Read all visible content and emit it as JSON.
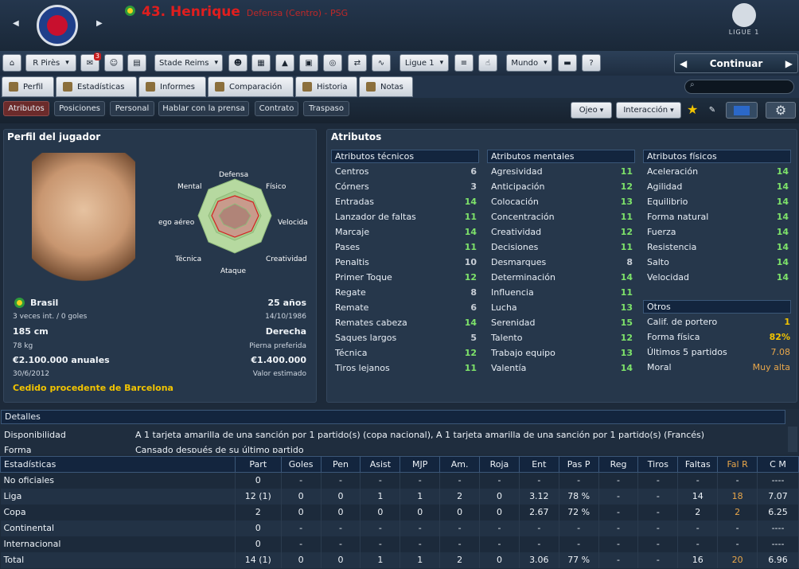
{
  "header": {
    "number_name": "43. Henrique",
    "position": "Defensa (Centro) - PSG",
    "league_logo_text": "LIGUE 1",
    "nav_prev": "◀",
    "nav_next": "▶"
  },
  "toolbar": {
    "manager": "R Pirès",
    "inbox_count": "3",
    "team": "Stade Reims",
    "competition": "Ligue 1",
    "world": "Mundo",
    "help": "?",
    "continue_label": "Continuar"
  },
  "tabs": [
    {
      "label": "Perfil"
    },
    {
      "label": "Estadísticas"
    },
    {
      "label": "Informes"
    },
    {
      "label": "Comparación"
    },
    {
      "label": "Historia"
    },
    {
      "label": "Notas"
    }
  ],
  "subtabs": [
    {
      "label": "Atributos"
    },
    {
      "label": "Posiciones"
    },
    {
      "label": "Personal"
    },
    {
      "label": "Hablar con la prensa"
    },
    {
      "label": "Contrato"
    },
    {
      "label": "Traspaso"
    }
  ],
  "view": {
    "eye": "Ojeo",
    "interaction": "Interacción"
  },
  "profile": {
    "title": "Perfil del jugador",
    "radar": {
      "top": "Defensa",
      "tr": "Físico",
      "r": "Velocida",
      "br": "Creatividad",
      "b": "Ataque",
      "bl": "Técnica",
      "l": "ego aéreo",
      "tl": "Mental"
    },
    "nation": "Brasil",
    "age": "25 años",
    "caps": "3 veces int. / 0 goles",
    "dob": "14/10/1986",
    "height": "185 cm",
    "foot": "Derecha",
    "weight": "78 kg",
    "foot_label": "Pierna preferida",
    "wage": "€2.100.000 anuales",
    "value": "€1.400.000",
    "contract_end": "30/6/2012",
    "value_label": "Valor estimado",
    "loan": "Cedido procedente de Barcelona"
  },
  "attributes": {
    "title": "Atributos",
    "technical": {
      "title": "Atributos técnicos",
      "items": [
        [
          "Centros",
          "6"
        ],
        [
          "Córners",
          "3"
        ],
        [
          "Entradas",
          "14"
        ],
        [
          "Lanzador de faltas",
          "11"
        ],
        [
          "Marcaje",
          "14"
        ],
        [
          "Pases",
          "11"
        ],
        [
          "Penaltis",
          "10"
        ],
        [
          "Primer Toque",
          "12"
        ],
        [
          "Regate",
          "8"
        ],
        [
          "Remate",
          "6"
        ],
        [
          "Remates cabeza",
          "14"
        ],
        [
          "Saques largos",
          "5"
        ],
        [
          "Técnica",
          "12"
        ],
        [
          "Tiros lejanos",
          "11"
        ]
      ]
    },
    "mental": {
      "title": "Atributos mentales",
      "items": [
        [
          "Agresividad",
          "11"
        ],
        [
          "Anticipación",
          "12"
        ],
        [
          "Colocación",
          "13"
        ],
        [
          "Concentración",
          "11"
        ],
        [
          "Creatividad",
          "12"
        ],
        [
          "Decisiones",
          "11"
        ],
        [
          "Desmarques",
          "8"
        ],
        [
          "Determinación",
          "14"
        ],
        [
          "Influencia",
          "11"
        ],
        [
          "Lucha",
          "13"
        ],
        [
          "Serenidad",
          "15"
        ],
        [
          "Talento",
          "12"
        ],
        [
          "Trabajo equipo",
          "13"
        ],
        [
          "Valentía",
          "14"
        ]
      ]
    },
    "physical": {
      "title": "Atributos físicos",
      "items": [
        [
          "Aceleración",
          "14"
        ],
        [
          "Agilidad",
          "14"
        ],
        [
          "Equilibrio",
          "14"
        ],
        [
          "Forma natural",
          "14"
        ],
        [
          "Fuerza",
          "14"
        ],
        [
          "Resistencia",
          "14"
        ],
        [
          "Salto",
          "14"
        ],
        [
          "Velocidad",
          "14"
        ]
      ]
    },
    "other": {
      "title": "Otros",
      "items": [
        [
          "Calif. de portero",
          "1"
        ],
        [
          "Forma física",
          "82%"
        ],
        [
          "Últimos 5 partidos",
          "7.08"
        ],
        [
          "Moral",
          "Muy alta"
        ]
      ]
    }
  },
  "details": {
    "title": "Detalles",
    "rows": [
      [
        "Disponibilidad",
        "A 1 tarjeta amarilla de una sanción por 1 partido(s) (copa nacional), A 1 tarjeta amarilla de una sanción por 1 partido(s) (Francés)"
      ],
      [
        "Forma",
        "Cansado después de su último partido"
      ]
    ]
  },
  "stats": {
    "headers": [
      "Estadísticas",
      "Part",
      "Goles",
      "Pen",
      "Asist",
      "MJP",
      "Am.",
      "Roja",
      "Ent",
      "Pas P",
      "Reg",
      "Tiros",
      "Faltas",
      "Fal R",
      "C M"
    ],
    "rows": [
      [
        "No oficiales",
        "0",
        "-",
        "-",
        "-",
        "-",
        "-",
        "-",
        "-",
        "-",
        "-",
        "-",
        "-",
        "-",
        "----"
      ],
      [
        "Liga",
        "12 (1)",
        "0",
        "0",
        "1",
        "1",
        "2",
        "0",
        "3.12",
        "78 %",
        "-",
        "-",
        "14",
        "18",
        "7.07"
      ],
      [
        "Copa",
        "2",
        "0",
        "0",
        "0",
        "0",
        "0",
        "0",
        "2.67",
        "72 %",
        "-",
        "-",
        "2",
        "2",
        "6.25"
      ],
      [
        "Continental",
        "0",
        "-",
        "-",
        "-",
        "-",
        "-",
        "-",
        "-",
        "-",
        "-",
        "-",
        "-",
        "-",
        "----"
      ],
      [
        "Internacional",
        "0",
        "-",
        "-",
        "-",
        "-",
        "-",
        "-",
        "-",
        "-",
        "-",
        "-",
        "-",
        "-",
        "----"
      ],
      [
        "Total",
        "14 (1)",
        "0",
        "0",
        "1",
        "1",
        "2",
        "0",
        "3.06",
        "77 %",
        "-",
        "-",
        "16",
        "20",
        "6.96"
      ]
    ]
  },
  "colors": {
    "green": "#7ee36a",
    "gray": "#c8ced6",
    "orange": "#e8a64a",
    "yellow": "#f2c400"
  }
}
